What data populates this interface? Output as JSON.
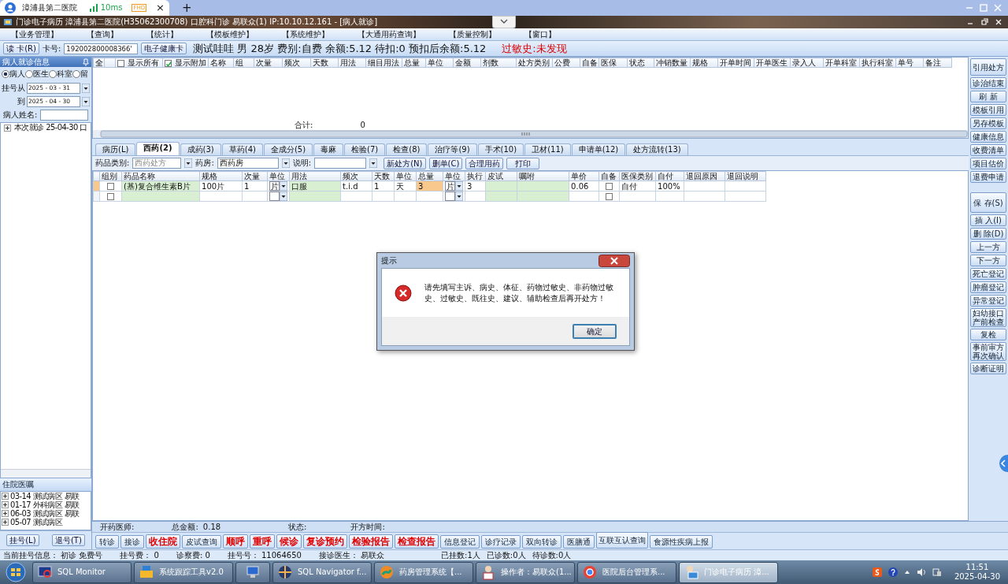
{
  "browser": {
    "tab_title": "漳浦县第二医院",
    "latency": "10ms",
    "badge": "FHD",
    "close": "×",
    "new_tab": "+"
  },
  "window": {
    "title": "门诊电子病历  漳浦县第二医院(H35062300708)  口腔科门诊  易联众(1) IP:10.10.12.161 - [病人就诊]"
  },
  "menu": [
    "【业务管理】",
    "【查询】",
    "【统计】",
    "【模板维护】",
    "【系统维护】",
    "【大通用药查询】",
    "【质量控制】",
    "【窗口】"
  ],
  "patient_bar": {
    "read_card": "读 卡(R)",
    "card_label": "卡号:",
    "card_value": "192002800008366'",
    "health_card": "电子健康卡",
    "info": "测试哇哇 男 28岁 费别:自费 余额:5.12 待扣:0 预扣后余额:5.12",
    "allergy": "过敏史:未发现"
  },
  "left_panel": {
    "title": "病人就诊信息",
    "filters": [
      {
        "label": "病人",
        "selected": true
      },
      {
        "label": "医生",
        "selected": false
      },
      {
        "label": "科室",
        "selected": false
      },
      {
        "label": "留",
        "selected": false
      }
    ],
    "from_label": "挂号从",
    "from": "2025 - 03 - 31",
    "to_label": "到",
    "to": "2025 - 04 - 30",
    "name_label": "病人姓名:",
    "visits": [
      {
        "label": "本次就诊 25-04-30 口",
        "expanded": false
      }
    ],
    "orders_title": "住院医嘱",
    "orders": [
      {
        "label": "03-14 测试病区 易联",
        "expanded": false
      },
      {
        "label": "01-17 外科病区 易联",
        "expanded": false
      },
      {
        "label": "06-03 测试病区 易联",
        "expanded": false
      },
      {
        "label": "05-07 测试病区",
        "expanded": false
      }
    ],
    "buttons": [
      "挂号(L)",
      "退号(T)"
    ]
  },
  "orders_grid": {
    "select_all": "全",
    "show_all": {
      "label": "显示所有",
      "checked": false
    },
    "show_extra": {
      "label": "显示附加",
      "checked": true
    },
    "columns": [
      "名称",
      "组",
      "次量",
      "频次",
      "天数",
      "用法",
      "细目用法",
      "总量",
      "单位",
      "金额",
      "剂数",
      "处方类别",
      "公费",
      "自备",
      "医保",
      "状态",
      "冲销数量",
      "规格",
      "开单时间",
      "开单医生",
      "录入人",
      "开单科室",
      "执行科室",
      "单号",
      "备注"
    ],
    "total_label": "合计:",
    "total": "0"
  },
  "tabs": [
    {
      "label": "病历(L)",
      "selected": false
    },
    {
      "label": "西药(2)",
      "selected": true
    },
    {
      "label": "成药(3)",
      "selected": false
    },
    {
      "label": "草药(4)",
      "selected": false
    },
    {
      "label": "全成分(5)",
      "selected": false
    },
    {
      "label": "毒麻",
      "selected": false
    },
    {
      "label": "检验(7)",
      "selected": false
    },
    {
      "label": "检查(8)",
      "selected": false
    },
    {
      "label": "治疗等(9)",
      "selected": false
    },
    {
      "label": "手术(10)",
      "selected": false
    },
    {
      "label": "卫材(11)",
      "selected": false
    },
    {
      "label": "申请单(12)",
      "selected": false
    },
    {
      "label": "处方流转(13)",
      "selected": false
    }
  ],
  "toolbar": {
    "category_label": "药品类别:",
    "category": "西药处方",
    "pharmacy_label": "药房:",
    "pharmacy": "西药房",
    "note_label": "说明:",
    "buttons": [
      "新处方(N)",
      "删单(C)",
      "合理用药",
      "打印"
    ]
  },
  "drug_grid": {
    "columns": [
      "组别",
      "药品名称",
      "规格",
      "次量",
      "单位",
      "用法",
      "频次",
      "天数",
      "单位",
      "总量",
      "单位",
      "执行",
      "皮试",
      "嘱咐",
      "单价",
      "自备",
      "医保类别",
      "自付",
      "退回原因",
      "退回说明"
    ],
    "rows": [
      {
        "selected": true,
        "group": false,
        "drug": "(基)复合维生素B片",
        "spec": "100片",
        "dose": "1",
        "dose_unit": "片",
        "usage": "口服",
        "freq": "t.i.d",
        "days": "1",
        "days_unit": "天",
        "total": "3",
        "total_unit": "片",
        "execute": "3",
        "price": "0.06",
        "self_supplied": false,
        "insurance_type": "自付",
        "self_pay": "100%"
      },
      {
        "selected": false,
        "group": false,
        "self_supplied": false
      }
    ]
  },
  "footer": {
    "doctor_label": "开药医师:",
    "amount_label": "总金额:",
    "amount": "0.18",
    "status_label": "状态:",
    "time_label": "开方时间:"
  },
  "actions": [
    {
      "label": "转诊",
      "kind": "normal"
    },
    {
      "label": "接诊",
      "kind": "normal"
    },
    {
      "label": "收住院",
      "kind": "alert"
    },
    {
      "label": "皮试查询",
      "kind": "normal"
    },
    {
      "label": "顺呼",
      "kind": "alert"
    },
    {
      "label": "重呼",
      "kind": "alert"
    },
    {
      "label": "候诊",
      "kind": "alert"
    },
    {
      "label": "复诊预约",
      "kind": "alert"
    },
    {
      "label": "检验报告",
      "kind": "alert"
    },
    {
      "label": "检查报告",
      "kind": "alert"
    },
    {
      "label": "信息登记",
      "kind": "normal"
    },
    {
      "label": "诊疗记录",
      "kind": "normal"
    },
    {
      "label": "双向转诊",
      "kind": "normal"
    },
    {
      "label": "医膳通",
      "kind": "normal"
    },
    {
      "label": "互联互认查询",
      "kind": "normal"
    },
    {
      "label": "食源性疾病上报",
      "kind": "normal"
    }
  ],
  "side_buttons": [
    "引用处方",
    "诊治结束",
    "刷 新",
    "模板引用",
    "另存模板",
    "健康信息",
    "收费清单",
    "项目估价",
    "退费申请",
    "保 存(S)",
    "插 入(I)",
    "删 除(D)",
    "上一方",
    "下一方",
    "死亡登记",
    "肿瘤登记",
    "异常登记",
    "妇幼接口产前检查",
    "复检",
    "事前审方再次确认",
    "诊断证明"
  ],
  "status_bar": [
    "当前挂号信息： 初诊 免费号",
    "挂号费： 0",
    "诊察费: 0",
    "挂号号： 11064650",
    "接诊医生： 易联众",
    "已挂数:1人",
    "已诊数:0人",
    "待诊数:0人"
  ],
  "dialog": {
    "title": "提示",
    "message": "请先填写主诉、病史、体征、药物过敏史、非药物过敏史、过敏史、既往史、建议、辅助检查后再开处方！",
    "ok": "确定"
  },
  "taskbar": {
    "items": [
      {
        "label": "SQL Monitor",
        "selected": false
      },
      {
        "label": "系统跟踪工具v2.0",
        "selected": false
      },
      {
        "kind": "icon",
        "selected": false
      },
      {
        "label": "SQL Navigator f...",
        "selected": false
      },
      {
        "label": "药房管理系统【...",
        "selected": false
      },
      {
        "label": "操作者：易联众(1...",
        "selected": false
      },
      {
        "label": "医院后台管理系...",
        "selected": false
      },
      {
        "label": "门诊电子病历  漳...",
        "selected": true
      }
    ],
    "time": "11:51",
    "date": "2025-04-30"
  }
}
